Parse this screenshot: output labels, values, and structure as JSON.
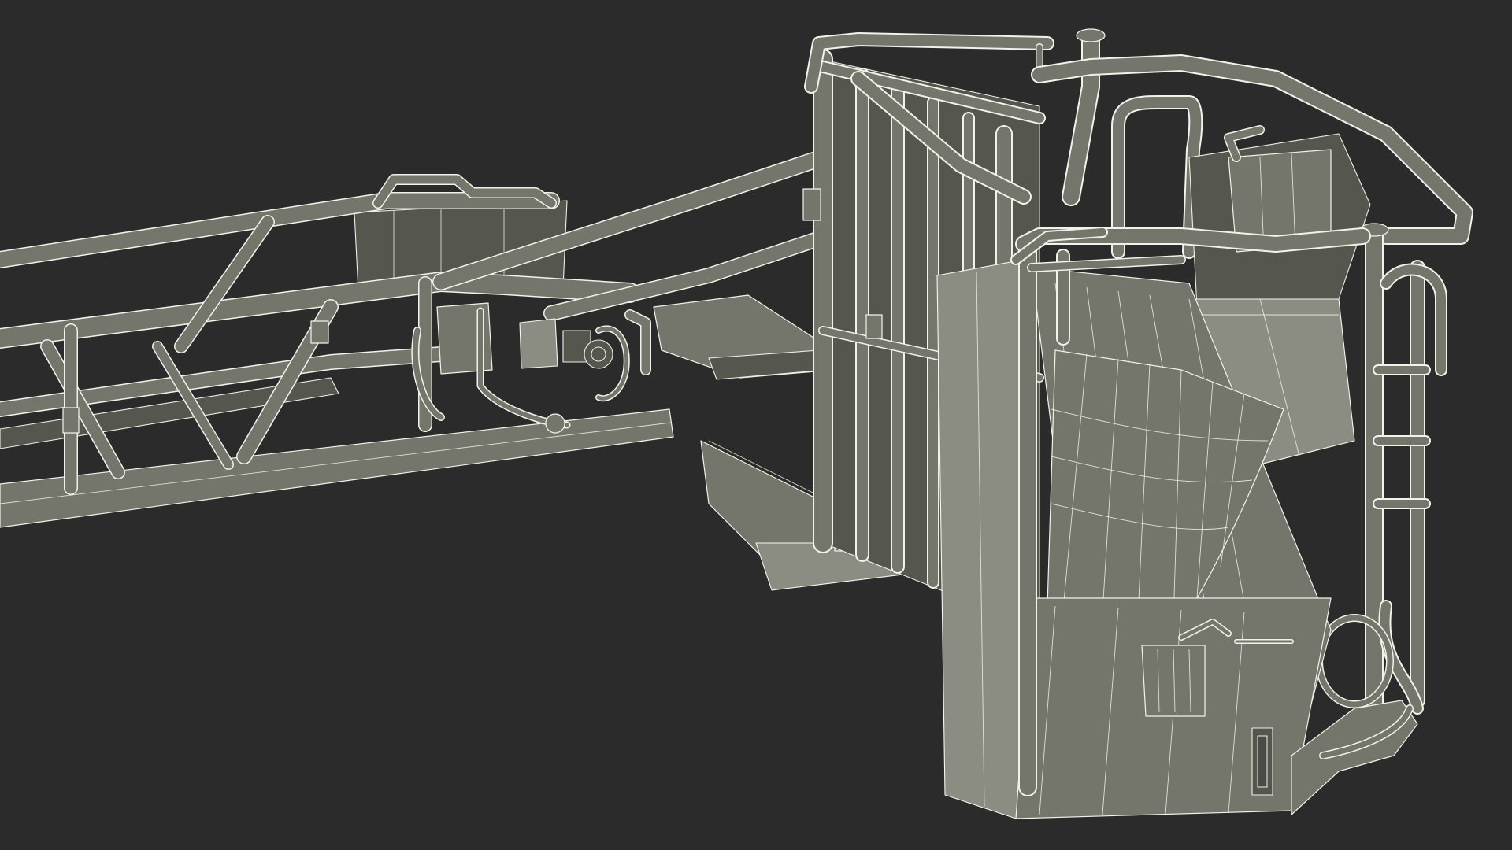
{
  "scene": {
    "colors": {
      "background": "#2b2b2b",
      "surface": "#74766c",
      "surface_dark": "#55574f",
      "surface_light": "#8b8d82",
      "wireframe": "#f2f2ea"
    }
  }
}
